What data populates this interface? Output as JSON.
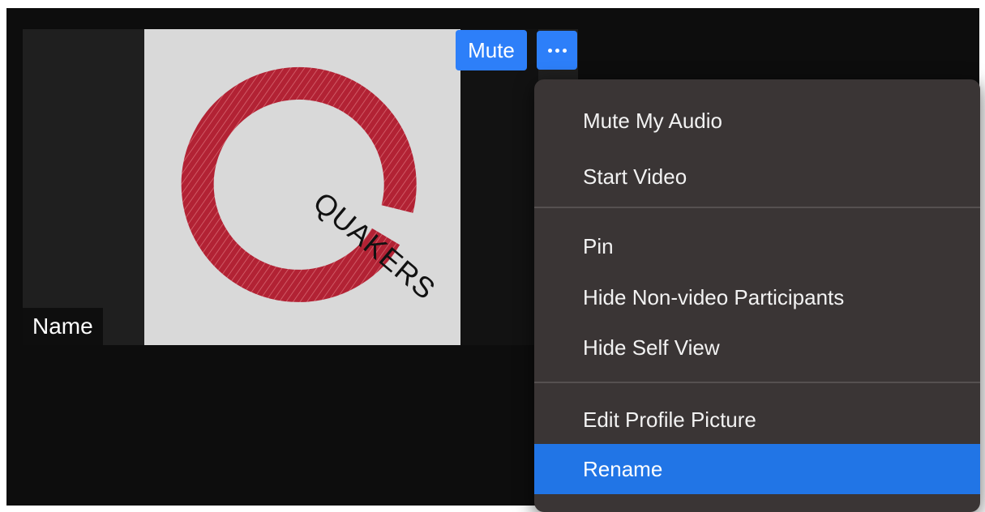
{
  "participant": {
    "name_label": "Name",
    "avatar_text": "QUAKERS",
    "avatar_color": "#b22234"
  },
  "toolbar": {
    "mute_label": "Mute",
    "more_icon": "more-dots-icon"
  },
  "context_menu": {
    "items": [
      {
        "label": "Mute My Audio"
      },
      {
        "label": "Start Video"
      },
      {
        "label": "Pin"
      },
      {
        "label": "Hide Non-video Participants"
      },
      {
        "label": "Hide Self View"
      },
      {
        "label": "Edit Profile Picture"
      },
      {
        "label": "Rename",
        "selected": true
      }
    ]
  },
  "colors": {
    "accent": "#2d7ff9",
    "menu_background": "#3a3535",
    "selection": "#2175e6"
  }
}
